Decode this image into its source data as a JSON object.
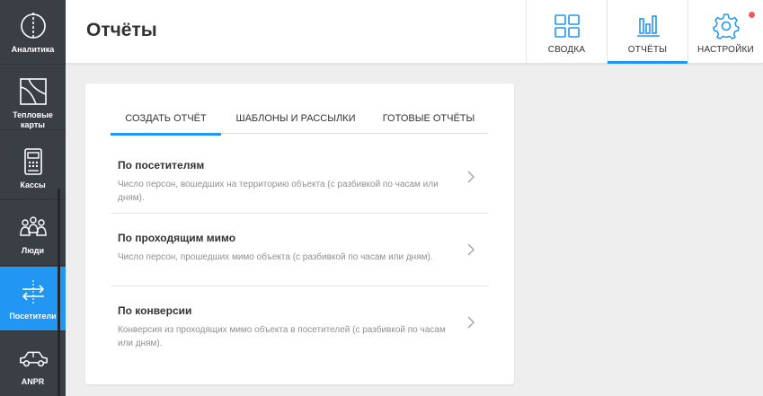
{
  "sidebar": {
    "items": [
      {
        "label": "Аналитика",
        "icon": "analytics-icon"
      },
      {
        "label": "Тепловые карты",
        "icon": "heatmap-icon"
      },
      {
        "label": "Кассы",
        "icon": "cash-register-icon"
      },
      {
        "label": "Люди",
        "icon": "people-icon"
      },
      {
        "label": "Посетители",
        "icon": "visitors-icon",
        "active": true
      },
      {
        "label": "ANPR",
        "icon": "car-icon"
      }
    ]
  },
  "header": {
    "title": "Отчёты",
    "tabs": [
      {
        "label": "СВОДКА",
        "icon": "dashboard-icon"
      },
      {
        "label": "ОТЧЁТЫ",
        "icon": "bar-chart-icon",
        "active": true
      },
      {
        "label": "НАСТРОЙКИ",
        "icon": "gear-icon",
        "has_notification": true
      }
    ]
  },
  "reports": {
    "tabs": [
      {
        "label": "СОЗДАТЬ ОТЧЁТ",
        "active": true
      },
      {
        "label": "ШАБЛОНЫ И РАССЫЛКИ"
      },
      {
        "label": "ГОТОВЫЕ ОТЧЁТЫ"
      }
    ],
    "items": [
      {
        "title": "По посетителям",
        "description": "Число персон, вошедших на территорию объекта (с разбивкой по часам или дням)."
      },
      {
        "title": "По проходящим мимо",
        "description": "Число персон, прошедших мимо объекта (с разбивкой по часам или дням)."
      },
      {
        "title": "По конверсии",
        "description": "Конверсия из проходящих мимо объекта в посетителей (с разбивкой по часам или дням)."
      }
    ]
  },
  "colors": {
    "accent": "#2196f3",
    "sidebar_bg": "#3a3e45",
    "notification": "#f05a5a"
  }
}
